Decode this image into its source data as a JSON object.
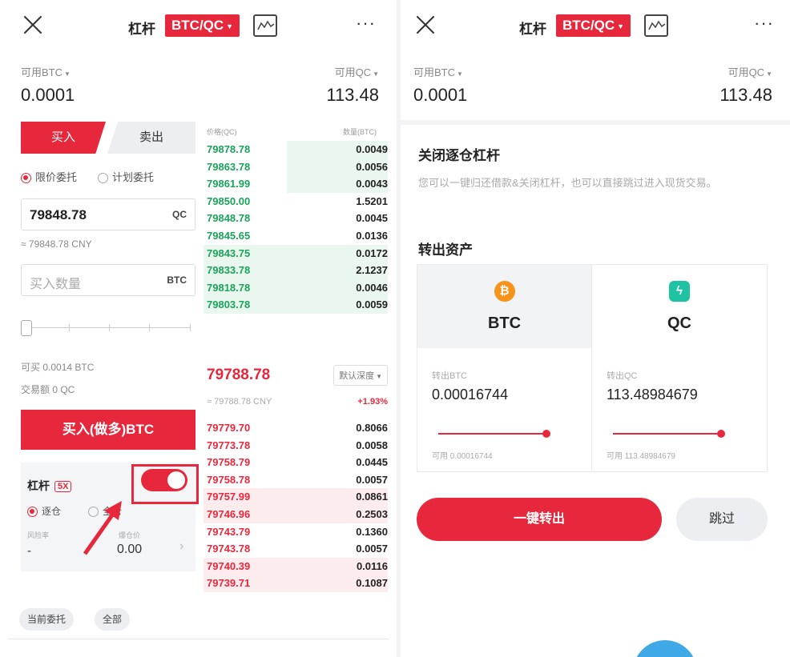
{
  "left": {
    "header": {
      "title": "杠杆",
      "pair": "BTC/QC"
    },
    "avail_btc_label": "可用BTC",
    "avail_btc_value": "0.0001",
    "avail_qc_label": "可用QC",
    "avail_qc_value": "113.48",
    "tabs": {
      "buy": "买入",
      "sell": "卖出"
    },
    "order_types": {
      "limit": "限价委托",
      "plan": "计划委托"
    },
    "price_input": {
      "value": "79848.78",
      "unit": "QC"
    },
    "price_cny": "≈ 79848.78 CNY",
    "amount_input": {
      "placeholder": "买入数量",
      "unit": "BTC"
    },
    "can_buy": "可买 0.0014 BTC",
    "trade_amount": "交易额 0 QC",
    "buy_button": "买入(做多)BTC",
    "leverage": {
      "title": "杠杆",
      "badge": "5X",
      "isolated": "逐仓",
      "cross": "全仓",
      "risk_label": "风险率",
      "risk_value": "-",
      "price_label": "爆仓价",
      "price_value": "0.00"
    },
    "bottom_tabs": {
      "current": "当前委托",
      "all": "全部"
    },
    "orderbook": {
      "price_header": "价格(QC)",
      "qty_header": "数量(BTC)",
      "asks": [
        {
          "price": "79878.78",
          "qty": "0.0049",
          "depth": 0.55
        },
        {
          "price": "79863.78",
          "qty": "0.0056",
          "depth": 0.55
        },
        {
          "price": "79861.99",
          "qty": "0.0043",
          "depth": 0.55
        },
        {
          "price": "79850.00",
          "qty": "1.5201",
          "depth": 0.0
        },
        {
          "price": "79848.78",
          "qty": "0.0045",
          "depth": 0.0
        },
        {
          "price": "79845.65",
          "qty": "0.0136",
          "depth": 0.0
        },
        {
          "price": "79843.75",
          "qty": "0.0172",
          "depth": 1.0
        },
        {
          "price": "79833.78",
          "qty": "2.1237",
          "depth": 1.0
        },
        {
          "price": "79818.78",
          "qty": "0.0046",
          "depth": 1.0
        },
        {
          "price": "79803.78",
          "qty": "0.0059",
          "depth": 1.0
        }
      ],
      "last_price": "79788.78",
      "last_cny": "≈ 79788.78 CNY",
      "change": "+1.93%",
      "depth_label": "默认深度",
      "bids": [
        {
          "price": "79779.70",
          "qty": "0.8066",
          "depth": 0.0
        },
        {
          "price": "79773.78",
          "qty": "0.0058",
          "depth": 0.0
        },
        {
          "price": "79758.79",
          "qty": "0.0445",
          "depth": 0.0
        },
        {
          "price": "79758.78",
          "qty": "0.0057",
          "depth": 0.0
        },
        {
          "price": "79757.99",
          "qty": "0.0861",
          "depth": 1.0
        },
        {
          "price": "79746.96",
          "qty": "0.2503",
          "depth": 1.0
        },
        {
          "price": "79743.79",
          "qty": "0.1360",
          "depth": 0.0
        },
        {
          "price": "79743.78",
          "qty": "0.0057",
          "depth": 0.0
        },
        {
          "price": "79740.39",
          "qty": "0.0116",
          "depth": 1.0
        },
        {
          "price": "79739.71",
          "qty": "0.1087",
          "depth": 1.0
        }
      ]
    }
  },
  "right": {
    "header": {
      "title": "杠杆",
      "pair": "BTC/QC"
    },
    "avail_btc_label": "可用BTC",
    "avail_btc_value": "0.0001",
    "avail_qc_label": "可用QC",
    "avail_qc_value": "113.48",
    "close_title": "关闭逐仓杠杆",
    "close_desc": "您可以一键归还借款&关闭杠杆，也可以直接跳过进入现货交易。",
    "transfer_title": "转出资产",
    "btc": {
      "name": "BTC",
      "label": "转出BTC",
      "amount": "0.00016744",
      "avail": "可用 0.00016744"
    },
    "qc": {
      "name": "QC",
      "label": "转出QC",
      "amount": "113.48984679",
      "avail": "可用 113.48984679"
    },
    "transfer_button": "一键转出",
    "skip_button": "跳过"
  },
  "colors": {
    "accent": "#e7283c",
    "buy_green": "#1aa35a",
    "btc_orange": "#f7931a",
    "qc_teal": "#1fc3a4"
  }
}
